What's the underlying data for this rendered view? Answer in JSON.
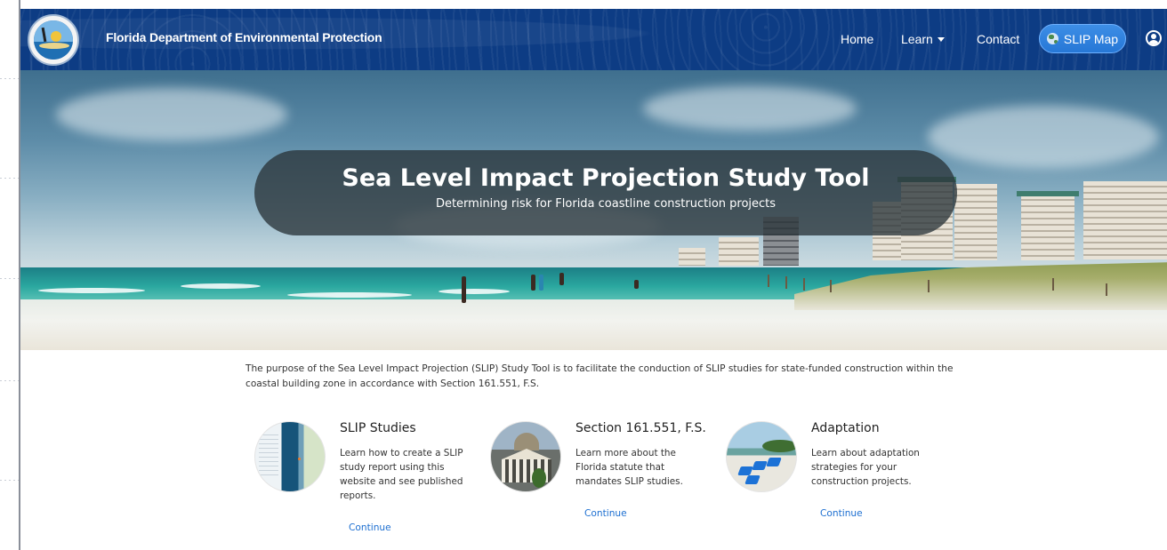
{
  "header": {
    "brand_title": "Florida Department of Environmental Protection",
    "nav": {
      "home": "Home",
      "learn": "Learn",
      "contact": "Contact"
    },
    "slip_map_button": "SLIP Map",
    "accent_color": "#0d3c84",
    "button_color": "#2677d6"
  },
  "hero": {
    "title": "Sea Level Impact Projection Study Tool",
    "subtitle": "Determining risk for Florida coastline construction projects"
  },
  "intro_text": "The purpose of the Sea Level Impact Projection (SLIP) Study Tool is to facilitate the conduction of SLIP studies for state-funded construction within the coastal building zone in accordance with Section 161.551, F.S.",
  "cards": [
    {
      "title": "SLIP Studies",
      "description": "Learn how to create a SLIP study report using this website and see published reports.",
      "link": "Continue"
    },
    {
      "title": "Section 161.551, F.S.",
      "description": "Learn more about the Florida statute that mandates SLIP studies.",
      "link": "Continue"
    },
    {
      "title": "Adaptation",
      "description": "Learn about adaptation strategies for your construction projects.",
      "link": "Continue"
    }
  ],
  "link_color": "#1d6fd1"
}
